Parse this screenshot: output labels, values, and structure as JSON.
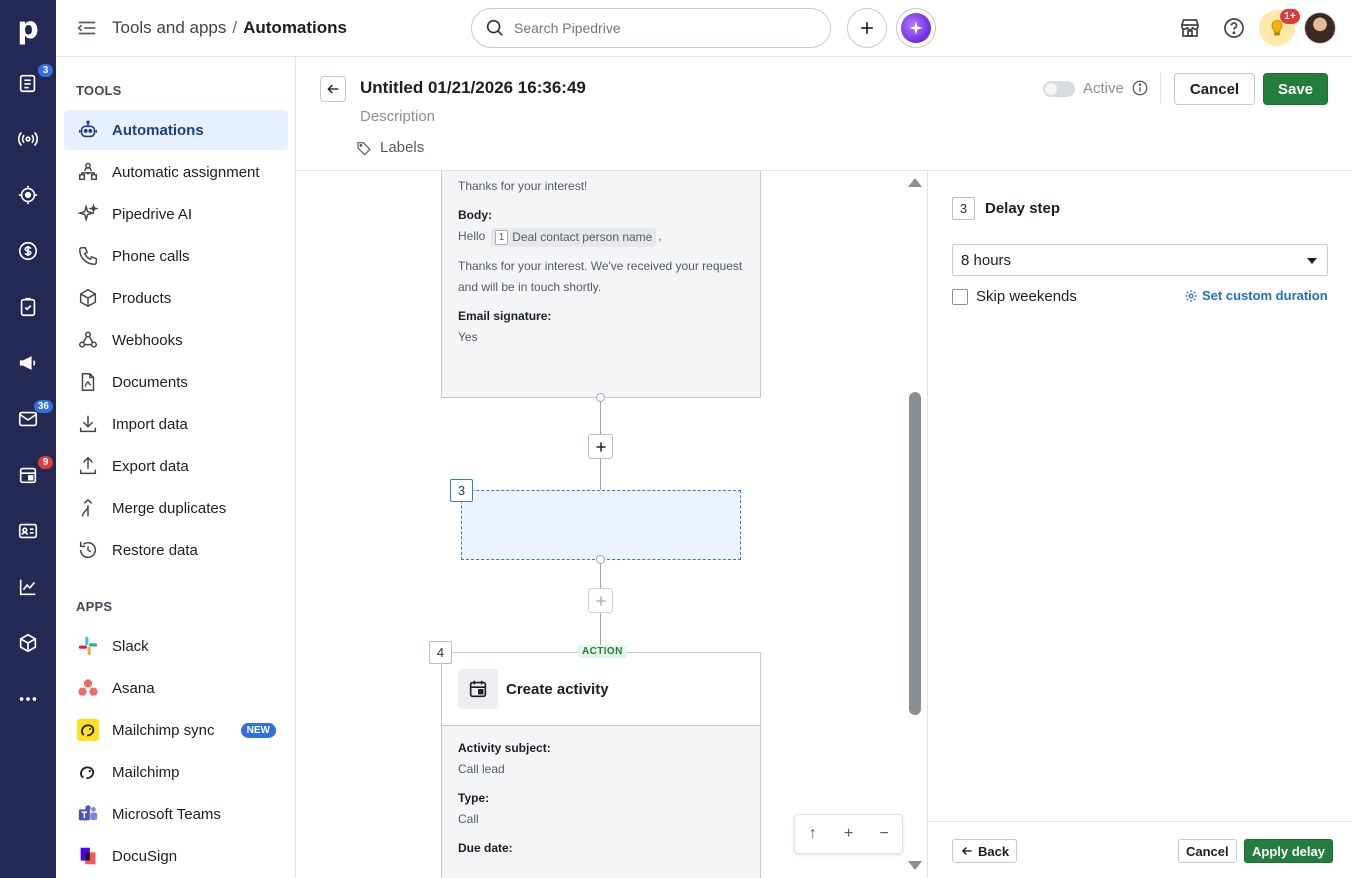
{
  "app": {
    "logo_letter": "p"
  },
  "rail": {
    "badges": {
      "leads": "3",
      "mail": "36",
      "calendar": "9"
    }
  },
  "topbar": {
    "breadcrumb_parent": "Tools and apps",
    "breadcrumb_sep": "/",
    "breadcrumb_current": "Automations",
    "search_placeholder": "Search Pipedrive",
    "notif_badge": "1+"
  },
  "nav": {
    "tools_heading": "TOOLS",
    "tools": [
      {
        "label": "Automations",
        "icon": "robot-icon"
      },
      {
        "label": "Automatic assignment",
        "icon": "assignment-icon"
      },
      {
        "label": "Pipedrive AI",
        "icon": "sparkle-icon"
      },
      {
        "label": "Phone calls",
        "icon": "phone-icon"
      },
      {
        "label": "Products",
        "icon": "box-icon"
      },
      {
        "label": "Webhooks",
        "icon": "webhook-icon"
      },
      {
        "label": "Documents",
        "icon": "document-icon"
      },
      {
        "label": "Import data",
        "icon": "import-icon"
      },
      {
        "label": "Export data",
        "icon": "export-icon"
      },
      {
        "label": "Merge duplicates",
        "icon": "merge-icon"
      },
      {
        "label": "Restore data",
        "icon": "restore-icon"
      }
    ],
    "apps_heading": "APPS",
    "apps": [
      {
        "label": "Slack",
        "icon": "slack-icon"
      },
      {
        "label": "Asana",
        "icon": "asana-icon"
      },
      {
        "label": "Mailchimp sync",
        "icon": "mailchimp-icon",
        "badge": "NEW"
      },
      {
        "label": "Mailchimp",
        "icon": "mailchimp-icon"
      },
      {
        "label": "Microsoft Teams",
        "icon": "teams-icon"
      },
      {
        "label": "DocuSign",
        "icon": "docusign-icon"
      }
    ]
  },
  "editor": {
    "title": "Untitled 01/21/2026 16:36:49",
    "description_placeholder": "Description",
    "labels": "Labels",
    "active_label": "Active",
    "active": false,
    "cancel": "Cancel",
    "save": "Save"
  },
  "canvas": {
    "email_card": {
      "subject_value": "Thanks for your interest!",
      "body_label": "Body:",
      "body_hello": "Hello",
      "body_chip_num": "1",
      "body_chip": "Deal contact person name",
      "body_comma": ",",
      "body_text": "Thanks for your interest. We've received your request and will be in touch shortly.",
      "signature_label": "Email signature:",
      "signature_value": "Yes"
    },
    "delay_step_num": "3",
    "action_card": {
      "step_num": "4",
      "tag": "ACTION",
      "title": "Create activity",
      "fields": [
        {
          "label": "Activity subject:",
          "value": "Call lead"
        },
        {
          "label": "Type:",
          "value": "Call"
        },
        {
          "label": "Due date:",
          "value": ""
        }
      ]
    }
  },
  "panel": {
    "step_num": "3",
    "title": "Delay step",
    "delay_value": "8 hours",
    "skip_weekends": "Skip weekends",
    "skip_weekends_checked": false,
    "custom_duration": "Set custom duration",
    "back": "Back",
    "cancel": "Cancel",
    "apply": "Apply delay"
  },
  "colors": {
    "rail": "#232854",
    "accent": "#237d3c",
    "link": "#1f6ed4",
    "active_nav_bg": "#e6f0ff"
  }
}
